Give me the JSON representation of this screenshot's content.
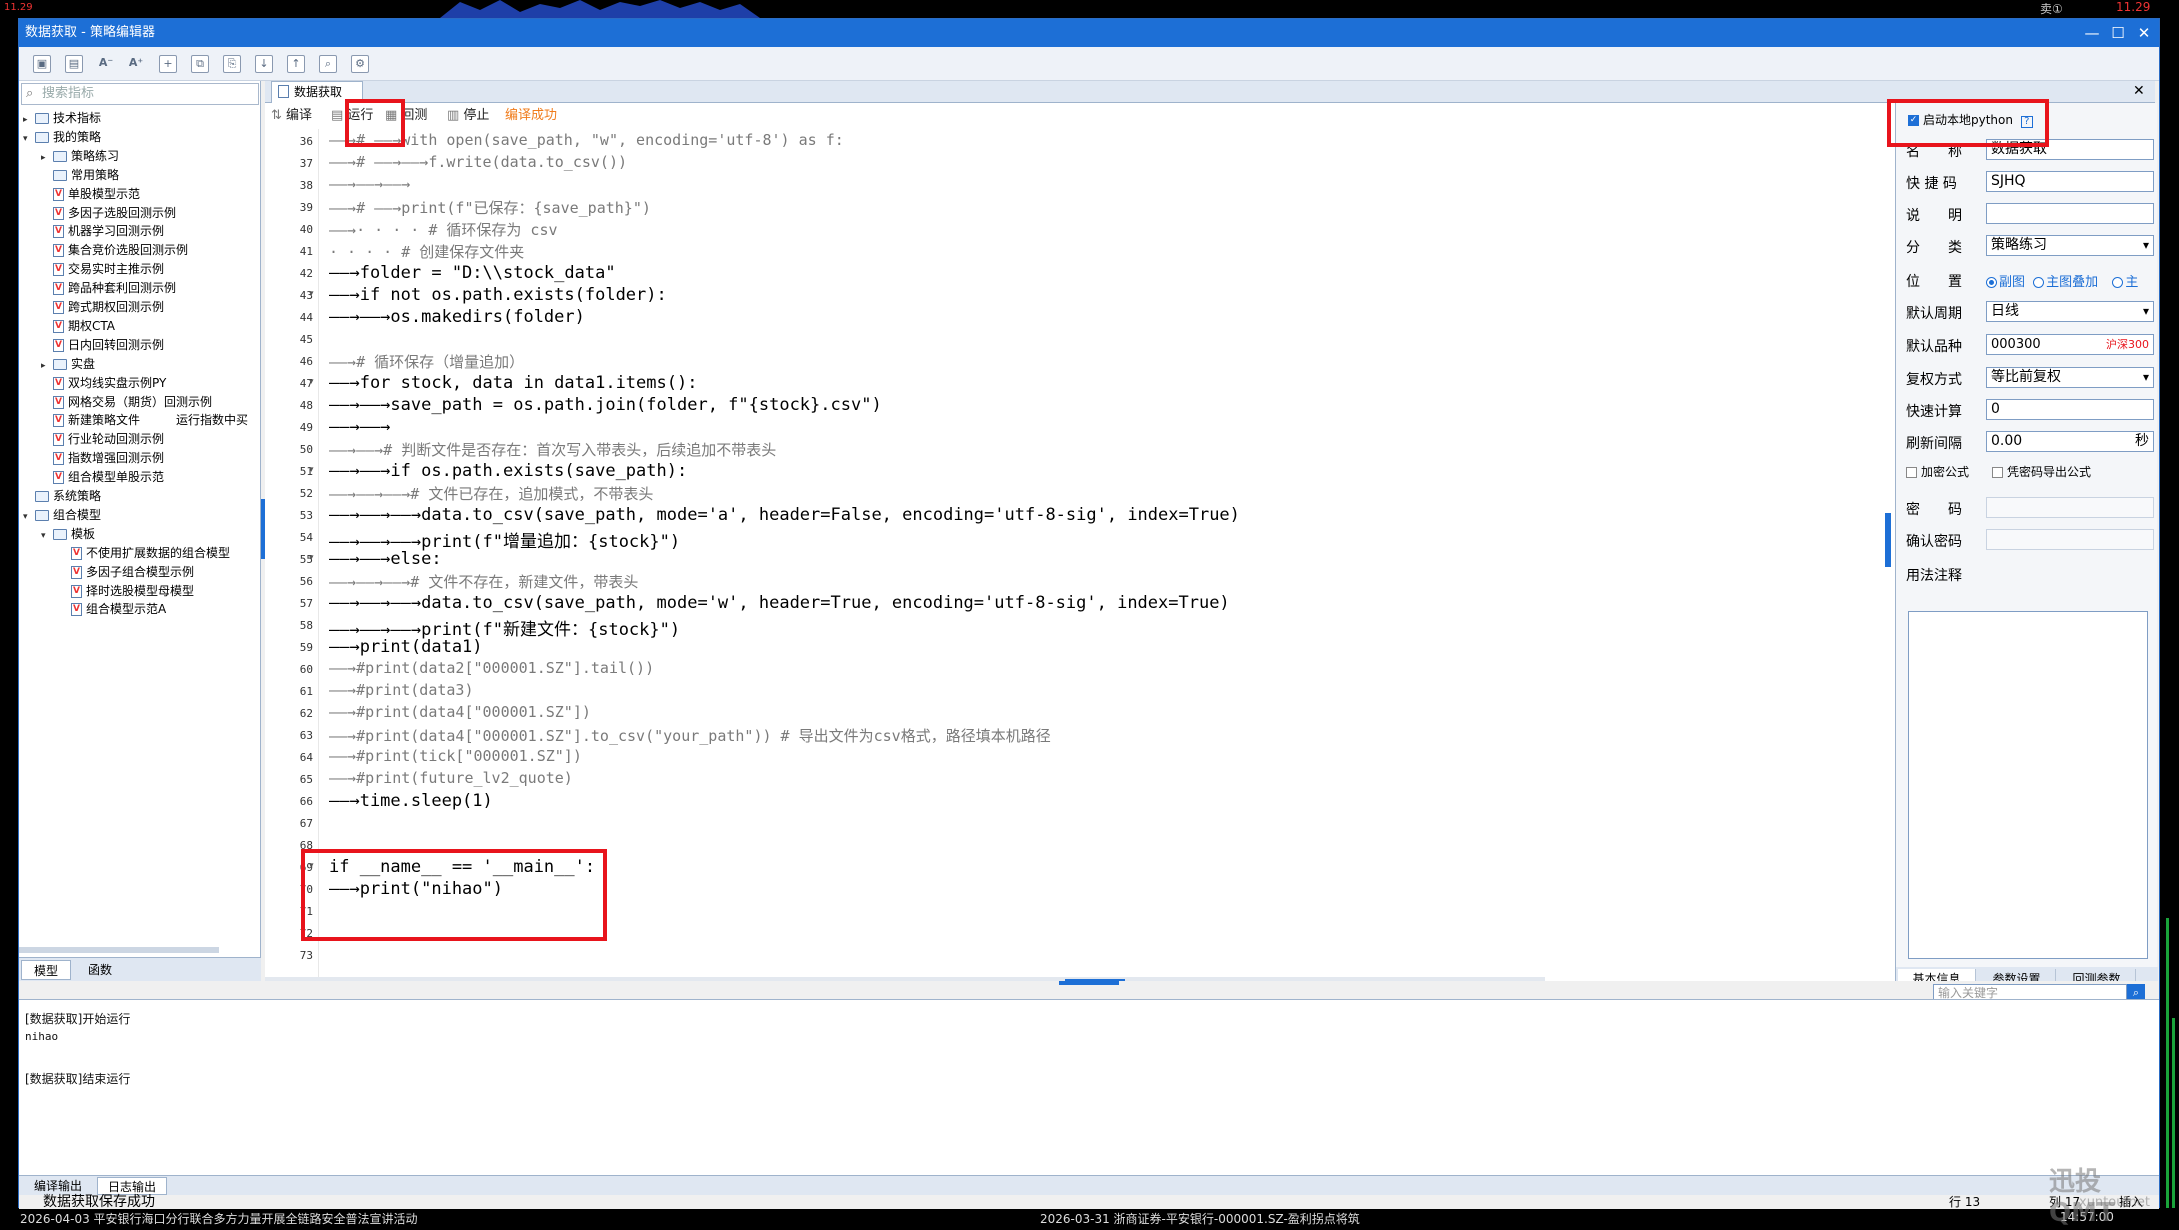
{
  "window": {
    "title": "数据获取 - 策略编辑器",
    "controls": {
      "minimize": "—",
      "maximize": "☐",
      "close": "✕"
    }
  },
  "outer": {
    "top_left_value": "11.29",
    "top_right_value": "11.29",
    "top_right_label": "卖①",
    "bottom_left_text": "2026-04-03  平安银行海口分行联合多方力量开展全链路安全普法宣讲活动",
    "bottom_mid_text": "2026-03-31  浙商证券-平安银行-000001.SZ-盈利拐点将筑",
    "bottom_time": "14:57:00"
  },
  "left_panel": {
    "search_placeholder": "搜索指标",
    "tree": [
      {
        "label": "技术指标",
        "type": "folder",
        "level": 0,
        "arrow": "▸"
      },
      {
        "label": "我的策略",
        "type": "folder",
        "level": 0,
        "arrow": "▾"
      },
      {
        "label": "策略练习",
        "type": "folder",
        "level": 1,
        "arrow": "▸"
      },
      {
        "label": "常用策略",
        "type": "folder",
        "level": 1,
        "arrow": ""
      },
      {
        "label": "单股模型示范",
        "type": "doc",
        "level": 1,
        "arrow": ""
      },
      {
        "label": "多因子选股回测示例",
        "type": "doc",
        "level": 1,
        "arrow": ""
      },
      {
        "label": "机器学习回测示例",
        "type": "doc",
        "level": 1,
        "arrow": ""
      },
      {
        "label": "集合竞价选股回测示例",
        "type": "doc",
        "level": 1,
        "arrow": ""
      },
      {
        "label": "交易实时主推示例",
        "type": "doc",
        "level": 1,
        "arrow": ""
      },
      {
        "label": "跨品种套利回测示例",
        "type": "doc",
        "level": 1,
        "arrow": ""
      },
      {
        "label": "跨式期权回测示例",
        "type": "doc",
        "level": 1,
        "arrow": ""
      },
      {
        "label": "期权CTA",
        "type": "doc",
        "level": 1,
        "arrow": ""
      },
      {
        "label": "日内回转回测示例",
        "type": "doc",
        "level": 1,
        "arrow": ""
      },
      {
        "label": "实盘",
        "type": "folder",
        "level": 1,
        "arrow": "▸"
      },
      {
        "label": "双均线实盘示例PY",
        "type": "doc",
        "level": 1,
        "arrow": ""
      },
      {
        "label": "网格交易（期货）回测示例",
        "type": "doc",
        "level": 1,
        "arrow": ""
      },
      {
        "label": "新建策略文件",
        "type": "doc",
        "level": 1,
        "arrow": "",
        "extra": "运行指数中买"
      },
      {
        "label": "行业轮动回测示例",
        "type": "doc",
        "level": 1,
        "arrow": ""
      },
      {
        "label": "指数增强回测示例",
        "type": "doc",
        "level": 1,
        "arrow": ""
      },
      {
        "label": "组合模型单股示范",
        "type": "doc",
        "level": 1,
        "arrow": ""
      },
      {
        "label": "系统策略",
        "type": "folder",
        "level": 0,
        "arrow": ""
      },
      {
        "label": "组合模型",
        "type": "folder",
        "level": 0,
        "arrow": "▾"
      },
      {
        "label": "模板",
        "type": "folder",
        "level": 1,
        "arrow": "▾"
      },
      {
        "label": "不使用扩展数据的组合模型",
        "type": "doc",
        "level": 2,
        "arrow": ""
      },
      {
        "label": "多因子组合模型示例",
        "type": "doc",
        "level": 2,
        "arrow": ""
      },
      {
        "label": "择时选股模型母模型",
        "type": "doc",
        "level": 2,
        "arrow": ""
      },
      {
        "label": "组合模型示范A",
        "type": "doc",
        "level": 2,
        "arrow": ""
      }
    ],
    "tabs": [
      "模型",
      "函数"
    ]
  },
  "editor": {
    "tab_label": "数据获取",
    "toolbar": {
      "compile": "编译",
      "run": "运行",
      "backtest": "回测",
      "stop": "停止",
      "status": "编译成功"
    },
    "status_color": "#f07b1a",
    "lines": [
      {
        "n": "36",
        "t": "——→# ——→with open(save_path, \"w\", encoding='utf-8') as f:",
        "c": "cm",
        "fold": ""
      },
      {
        "n": "37",
        "t": "——→# ——→——→f.write(data.to_csv())",
        "c": "cm",
        "fold": ""
      },
      {
        "n": "38",
        "t": "——→——→——→",
        "c": "cm",
        "fold": ""
      },
      {
        "n": "39",
        "t": "——→# ——→print(f\"已保存：{save_path}\")",
        "c": "cm",
        "fold": ""
      },
      {
        "n": "40",
        "t": "——→· · · · # 循环保存为 csv",
        "c": "cm",
        "fold": ""
      },
      {
        "n": "41",
        "t": "· · · · # 创建保存文件夹",
        "c": "cm",
        "fold": ""
      },
      {
        "n": "42",
        "t": "——→folder = \"D:\\\\stock_data\"",
        "c": "code",
        "fold": ""
      },
      {
        "n": "43",
        "t": "——→if not os.path.exists(folder):",
        "c": "code",
        "fold": "▾"
      },
      {
        "n": "44",
        "t": "——→——→os.makedirs(folder)",
        "c": "code",
        "fold": ""
      },
      {
        "n": "45",
        "t": "",
        "c": "code",
        "fold": ""
      },
      {
        "n": "46",
        "t": "——→# 循环保存（增量追加）",
        "c": "cm",
        "fold": ""
      },
      {
        "n": "47",
        "t": "——→for stock, data in data1.items():",
        "c": "code",
        "fold": "▾"
      },
      {
        "n": "48",
        "t": "——→——→save_path = os.path.join(folder, f\"{stock}.csv\")",
        "c": "code",
        "fold": ""
      },
      {
        "n": "49",
        "t": "——→——→",
        "c": "code",
        "fold": ""
      },
      {
        "n": "50",
        "t": "——→——→# 判断文件是否存在：首次写入带表头，后续追加不带表头",
        "c": "cm",
        "fold": ""
      },
      {
        "n": "51",
        "t": "——→——→if os.path.exists(save_path):",
        "c": "code",
        "fold": "▾"
      },
      {
        "n": "52",
        "t": "——→——→——→# 文件已存在，追加模式，不带表头",
        "c": "cm",
        "fold": ""
      },
      {
        "n": "53",
        "t": "——→——→——→data.to_csv(save_path, mode='a', header=False, encoding='utf-8-sig', index=True)",
        "c": "code",
        "fold": ""
      },
      {
        "n": "54",
        "t": "——→——→——→print(f\"增量追加：{stock}\")",
        "c": "code",
        "fold": ""
      },
      {
        "n": "55",
        "t": "——→——→else:",
        "c": "code",
        "fold": "▾"
      },
      {
        "n": "56",
        "t": "——→——→——→# 文件不存在，新建文件，带表头",
        "c": "cm",
        "fold": ""
      },
      {
        "n": "57",
        "t": "——→——→——→data.to_csv(save_path, mode='w', header=True, encoding='utf-8-sig', index=True)",
        "c": "code",
        "fold": ""
      },
      {
        "n": "58",
        "t": "——→——→——→print(f\"新建文件：{stock}\")",
        "c": "code",
        "fold": ""
      },
      {
        "n": "59",
        "t": "——→print(data1)",
        "c": "code",
        "fold": ""
      },
      {
        "n": "60",
        "t": "——→#print(data2[\"000001.SZ\"].tail())",
        "c": "cm",
        "fold": ""
      },
      {
        "n": "61",
        "t": "——→#print(data3)",
        "c": "cm",
        "fold": ""
      },
      {
        "n": "62",
        "t": "——→#print(data4[\"000001.SZ\"])",
        "c": "cm",
        "fold": ""
      },
      {
        "n": "63",
        "t": "——→#print(data4[\"000001.SZ\"].to_csv(\"your_path\")) # 导出文件为csv格式，路径填本机路径",
        "c": "cm",
        "fold": ""
      },
      {
        "n": "64",
        "t": "——→#print(tick[\"000001.SZ\"])",
        "c": "cm",
        "fold": ""
      },
      {
        "n": "65",
        "t": "——→#print(future_lv2_quote)",
        "c": "cm",
        "fold": ""
      },
      {
        "n": "66",
        "t": "——→time.sleep(1)",
        "c": "code",
        "fold": ""
      },
      {
        "n": "67",
        "t": "",
        "c": "code",
        "fold": ""
      },
      {
        "n": "68",
        "t": "",
        "c": "code",
        "fold": ""
      },
      {
        "n": "69",
        "t": "if __name__ == '__main__':",
        "c": "code",
        "fold": "▾"
      },
      {
        "n": "70",
        "t": "——→print(\"nihao\")",
        "c": "code",
        "fold": ""
      },
      {
        "n": "71",
        "t": "",
        "c": "code",
        "fold": ""
      },
      {
        "n": "72",
        "t": "",
        "c": "code",
        "fold": ""
      },
      {
        "n": "73",
        "t": "",
        "c": "code",
        "fold": ""
      }
    ]
  },
  "right_panel": {
    "local_python_label": "启动本地python",
    "help_icon_text": "?",
    "fields": {
      "name_label": "名　　称",
      "name_value": "数据获取",
      "shortcut_label": "快 捷 码",
      "shortcut_value": "SJHQ",
      "desc_label": "说　　明",
      "desc_value": "",
      "category_label": "分　　类",
      "category_value": "策略练习",
      "position_label": "位　　置",
      "position_options": [
        "副图",
        "主图叠加",
        "主"
      ],
      "period_label": "默认周期",
      "period_value": "日线",
      "instrument_label": "默认品种",
      "instrument_value": "000300",
      "instrument_tag": "沪深300",
      "adjust_label": "复权方式",
      "adjust_value": "等比前复权",
      "fastcalc_label": "快速计算",
      "fastcalc_value": "0",
      "refresh_label": "刷新间隔",
      "refresh_value": "0.00",
      "refresh_unit": "秒",
      "encrypt_label": "加密公式",
      "export_label": "凭密码导出公式",
      "password_label": "密　　码",
      "confirm_label": "确认密码",
      "notes_label": "用法注释"
    },
    "tabs": [
      "基本信息",
      "参数设置",
      "回测参数"
    ]
  },
  "output": {
    "search_placeholder": "输入关键字",
    "lines": [
      "[数据获取]开始运行",
      "nihao",
      "",
      "[数据获取]结束运行"
    ],
    "tabs": [
      "编译输出",
      "日志输出"
    ]
  },
  "statusbar": {
    "message": "数据获取保存成功",
    "row_label": "行 13",
    "col_label": "列 17",
    "insert_label": "插入"
  },
  "watermark": {
    "brand": "迅投QMT",
    "site": "xuntou.net"
  }
}
